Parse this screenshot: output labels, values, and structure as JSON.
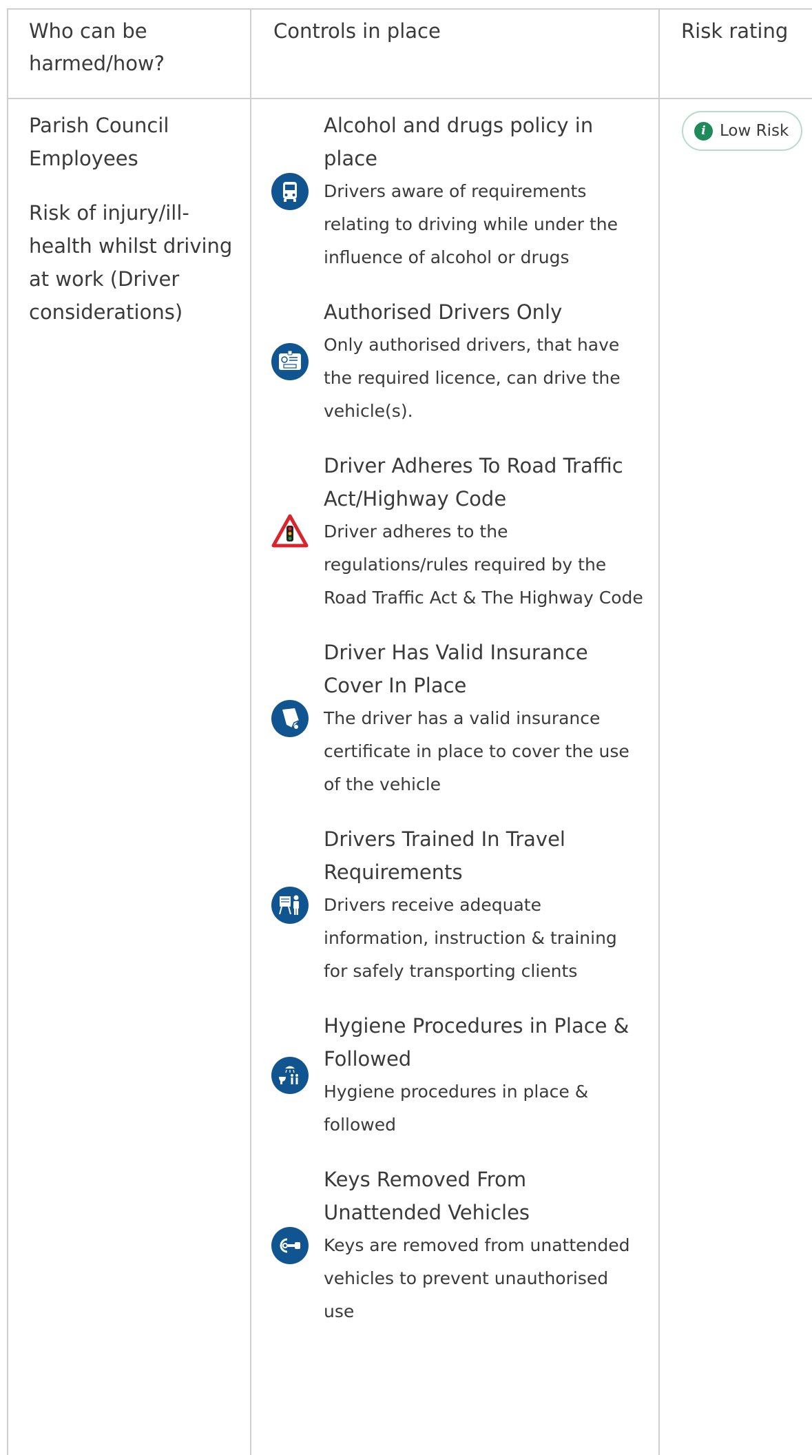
{
  "headers": {
    "who": "Who can be harmed/how?",
    "controls": "Controls in place",
    "rating": "Risk rating"
  },
  "who": {
    "group": "Parish Council Employees",
    "risk": "Risk of injury/ill-health whilst driving at work (Driver considerations)"
  },
  "controls": [
    {
      "icon": "bus-icon",
      "title": "Alcohol and drugs policy in place",
      "description": "Drivers aware of requirements relating to driving while under the influence of alcohol or drugs"
    },
    {
      "icon": "id-pass-icon",
      "title": "Authorised Drivers Only",
      "description": "Only authorised drivers, that have the required licence, can drive the vehicle(s)."
    },
    {
      "icon": "traffic-light-warning-icon",
      "title": "Driver Adheres To Road Traffic Act/Highway Code",
      "description": "Driver adheres to the regulations/rules required by the Road Traffic Act & The Highway Code"
    },
    {
      "icon": "insurance-certificate-icon",
      "title": "Driver Has Valid Insurance Cover In Place",
      "description": "The driver has a valid insurance certificate in place to cover the use of the vehicle"
    },
    {
      "icon": "training-presentation-icon",
      "title": "Drivers Trained In Travel Requirements",
      "description": "Drivers receive adequate information, instruction & training for safely transporting clients"
    },
    {
      "icon": "washroom-hygiene-icon",
      "title": "Hygiene Procedures in Place & Followed",
      "description": "Hygiene procedures in place & followed"
    },
    {
      "icon": "ignition-key-icon",
      "title": "Keys Removed From Unattended Vehicles",
      "description": "Keys are removed from unattended vehicles to prevent unauthorised use"
    }
  ],
  "rating": {
    "label": "Low Risk",
    "icon": "info-icon",
    "color": "#1f8a5a"
  },
  "colors": {
    "icon_blue": "#10558f",
    "warning_red": "#d9232d",
    "border": "#cfcfcf"
  }
}
